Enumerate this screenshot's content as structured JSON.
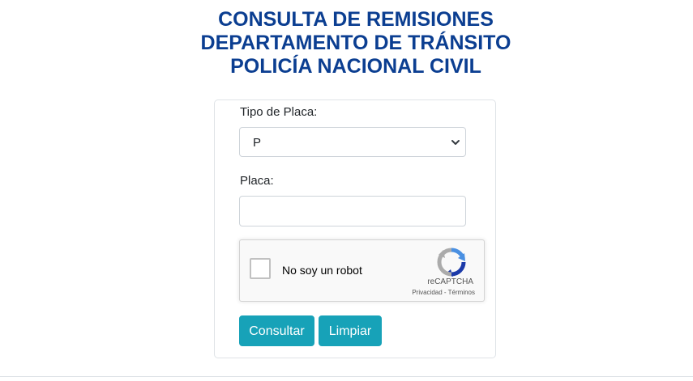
{
  "header": {
    "title_line1": "CONSULTA DE REMISIONES",
    "title_line2": "DEPARTAMENTO DE TRÁNSITO",
    "title_line3": "POLICÍA NACIONAL CIVIL",
    "title_color": "#0b3e91"
  },
  "form": {
    "plate_type_label": "Tipo de Placa:",
    "plate_type_selected": "P",
    "plate_label": "Placa:",
    "plate_value": "",
    "plate_placeholder": "",
    "recaptcha": {
      "checkbox_label": "No soy un robot",
      "brand": "reCAPTCHA",
      "privacy_link": "Privacidad",
      "separator": " - ",
      "terms_link": "Términos",
      "icon": "recaptcha-logo-icon"
    },
    "submit_label": "Consultar",
    "clear_label": "Limpiar",
    "button_color": "#17a2b8"
  }
}
